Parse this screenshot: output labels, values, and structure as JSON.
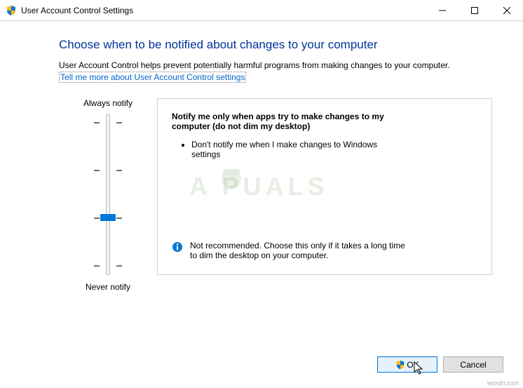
{
  "titlebar": {
    "title": "User Account Control Settings"
  },
  "heading": "Choose when to be notified about changes to your computer",
  "description": "User Account Control helps prevent potentially harmful programs from making changes to your computer.",
  "link": "Tell me more about User Account Control settings",
  "slider": {
    "top_label": "Always notify",
    "bottom_label": "Never notify",
    "levels": 4,
    "current_level": 2
  },
  "info": {
    "title": "Notify me only when apps try to make changes to my computer (do not dim my desktop)",
    "bullets": [
      "Don't notify me when I make changes to Windows settings"
    ],
    "recommendation": "Not recommended. Choose this only if it takes a long time to dim the desktop on your computer."
  },
  "buttons": {
    "ok": "OK",
    "cancel": "Cancel"
  },
  "watermark": "A  PUALS",
  "copyright": "wsxdn.com"
}
